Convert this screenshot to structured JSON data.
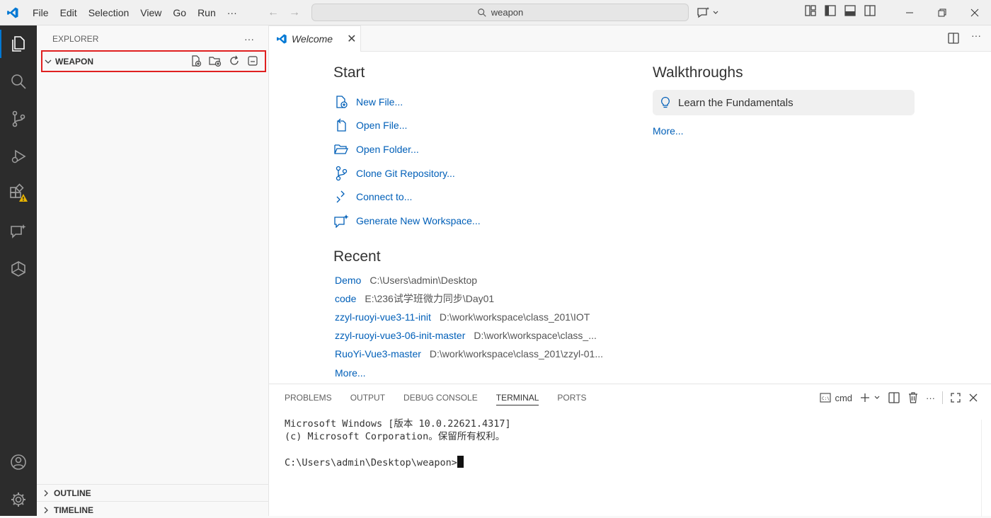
{
  "menu": [
    "File",
    "Edit",
    "Selection",
    "View",
    "Go",
    "Run",
    "···"
  ],
  "search": {
    "text": "weapon"
  },
  "sidebar": {
    "title": "EXPLORER",
    "more": "···",
    "folder": "WEAPON",
    "outline": "OUTLINE",
    "timeline": "TIMELINE"
  },
  "tab": {
    "label": "Welcome",
    "close": "✕"
  },
  "welcome": {
    "start_title": "Start",
    "start_items": [
      "New File...",
      "Open File...",
      "Open Folder...",
      "Clone Git Repository...",
      "Connect to...",
      "Generate New Workspace..."
    ],
    "recent_title": "Recent",
    "recent": [
      {
        "name": "Demo",
        "path": "C:\\Users\\admin\\Desktop"
      },
      {
        "name": "code",
        "path": "E:\\236试学班微力同步\\Day01"
      },
      {
        "name": "zzyl-ruoyi-vue3-11-init",
        "path": "D:\\work\\workspace\\class_201\\IOT"
      },
      {
        "name": "zzyl-ruoyi-vue3-06-init-master",
        "path": "D:\\work\\workspace\\class_..."
      },
      {
        "name": "RuoYi-Vue3-master",
        "path": "D:\\work\\workspace\\class_201\\zzyl-01..."
      }
    ],
    "recent_more": "More...",
    "walk_title": "Walkthroughs",
    "walk_item": "Learn the Fundamentals",
    "walk_more": "More..."
  },
  "panel": {
    "tabs": [
      "PROBLEMS",
      "OUTPUT",
      "DEBUG CONSOLE",
      "TERMINAL",
      "PORTS"
    ],
    "shell": "cmd",
    "terminal_lines": [
      "Microsoft Windows [版本 10.0.22621.4317]",
      "(c) Microsoft Corporation。保留所有权利。",
      "",
      "C:\\Users\\admin\\Desktop\\weapon>"
    ]
  },
  "colors": {
    "accent": "#0078d4",
    "link": "#005fb8",
    "highlight": "#e02020"
  }
}
